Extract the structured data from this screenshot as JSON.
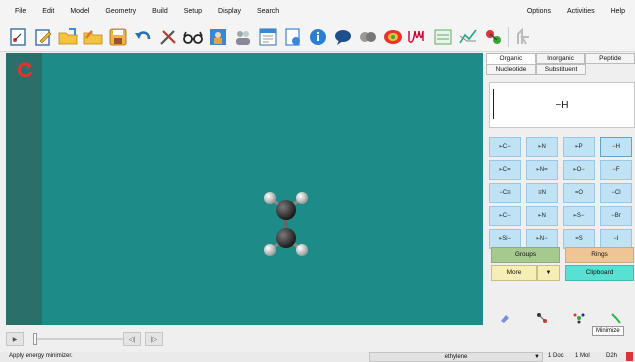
{
  "menu": {
    "left": [
      "File",
      "Edit",
      "Model",
      "Geometry",
      "Build",
      "Setup",
      "Display",
      "Search"
    ],
    "right": [
      "Options",
      "Activities",
      "Help"
    ]
  },
  "toolbar": {
    "icons": [
      "new-document-icon",
      "edit-icon",
      "open-folder-icon",
      "open-recent-icon",
      "save-icon",
      "undo-icon",
      "tools-icon",
      "view-glasses-icon",
      "builder-icon",
      "users-icon",
      "calculator-icon",
      "document-icon",
      "info-icon",
      "bubble-icon",
      "molecules-icon",
      "surface-icon",
      "spectrum-icon",
      "chart-icon",
      "plot-icon",
      "molecule-icon",
      "lock-icon"
    ]
  },
  "panel": {
    "tabs": [
      "Organic",
      "Inorganic",
      "Peptide"
    ],
    "tabs2": [
      "Nucleotide",
      "Substituent"
    ],
    "fragment": "−H",
    "grid": [
      [
        "⫦C−",
        "⫦N",
        "⫦P",
        "−H"
      ],
      [
        "⫦C=",
        "⫦N=",
        "⫦O−",
        "−F"
      ],
      [
        "−C≡",
        "≡N",
        "=O",
        "−Cl"
      ],
      [
        "⫦C−",
        "⫦N",
        "⫦S−",
        "−Br"
      ],
      [
        "⫦Si−",
        "⫦N−",
        "=S",
        "−I"
      ]
    ],
    "groups": "Groups",
    "rings": "Rings",
    "more": "More",
    "clipboard": "Clipboard",
    "tooltip": "Minimize"
  },
  "status": {
    "message": "Apply energy minimizer.",
    "molecule": "ethylene",
    "docs": "1 Doc",
    "mols": "1 Mol",
    "symmetry": "D2h"
  },
  "colors": {
    "canvas": "#1d8c88",
    "leftstrip": "#2b6f6a",
    "fragment_cell": "#bfe3f5",
    "groups": "#a6c98d",
    "rings": "#efc596",
    "more": "#f6eeb5",
    "clipboard": "#58e0d2"
  }
}
